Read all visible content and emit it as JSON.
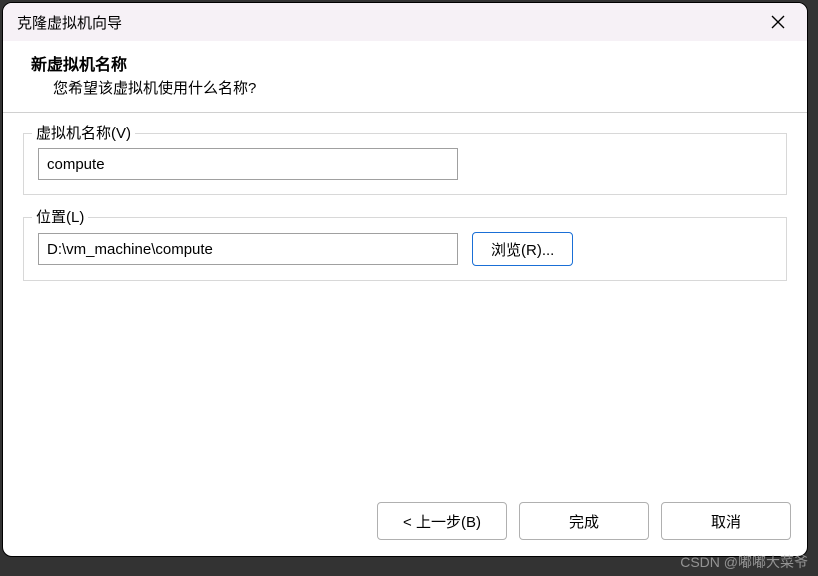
{
  "titlebar": {
    "title": "克隆虚拟机向导"
  },
  "header": {
    "title": "新虚拟机名称",
    "subtitle": "您希望该虚拟机使用什么名称?"
  },
  "form": {
    "name_field": {
      "label": "虚拟机名称(V)",
      "value": "compute"
    },
    "location_field": {
      "label": "位置(L)",
      "value": "D:\\vm_machine\\compute",
      "browse_label": "浏览(R)..."
    }
  },
  "footer": {
    "back_label": "< 上一步(B)",
    "finish_label": "完成",
    "cancel_label": "取消"
  },
  "watermark": "CSDN @嘟嘟大菜爷"
}
